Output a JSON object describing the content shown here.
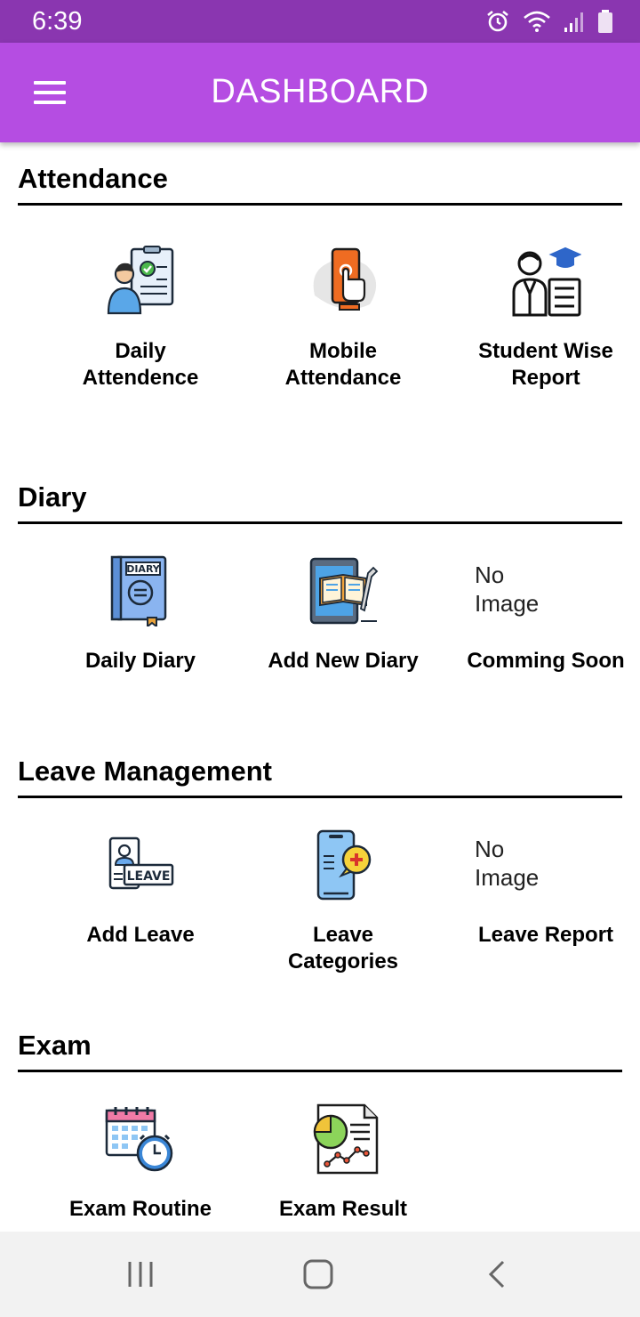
{
  "status_bar": {
    "time": "6:39",
    "icons": [
      "alarm-icon",
      "wifi-icon",
      "signal-icon",
      "battery-icon"
    ]
  },
  "app_bar": {
    "title": "DASHBOARD",
    "menu_icon": "hamburger-menu-icon",
    "color": "#b54de2"
  },
  "sections": {
    "attendance": {
      "title": "Attendance",
      "items": [
        {
          "label": "Daily\nAttendence",
          "icon": "daily-attendance-icon"
        },
        {
          "label": "Mobile\nAttendance",
          "icon": "mobile-attendance-icon"
        },
        {
          "label": "Student Wise\nReport",
          "icon": "student-report-icon"
        }
      ]
    },
    "diary": {
      "title": "Diary",
      "items": [
        {
          "label": "Daily Diary",
          "icon": "diary-book-icon"
        },
        {
          "label": "Add New Diary",
          "icon": "tablet-book-icon"
        },
        {
          "label": "Comming Soon",
          "placeholder": "No\nImage"
        }
      ]
    },
    "leave": {
      "title": "Leave Management",
      "items": [
        {
          "label": "Add Leave",
          "icon": "leave-card-icon"
        },
        {
          "label": "Leave\nCategories",
          "icon": "phone-medical-icon"
        },
        {
          "label": "Leave Report",
          "placeholder": "No\nImage"
        }
      ]
    },
    "exam": {
      "title": "Exam",
      "items": [
        {
          "label": "Exam Routine",
          "icon": "calendar-clock-icon"
        },
        {
          "label": "Exam Result",
          "icon": "result-chart-icon"
        }
      ]
    }
  },
  "nav_bar": {
    "icons": [
      "recent-apps-icon",
      "home-icon",
      "back-icon"
    ]
  }
}
